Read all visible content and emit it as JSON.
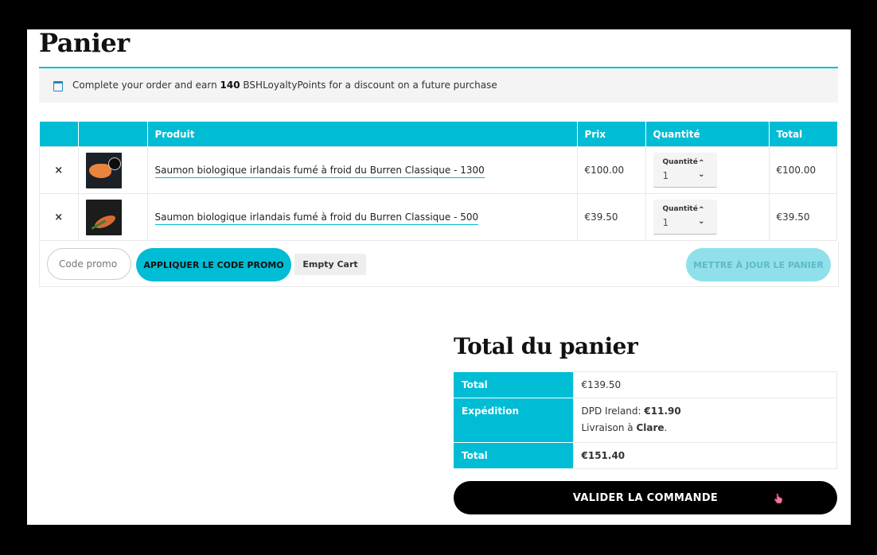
{
  "page_title": "Panier",
  "notice": {
    "text_before": "Complete your order and earn ",
    "points": "140",
    "text_after": " BSHLoyaltyPoints for a discount on a future purchase"
  },
  "cart_table": {
    "headers": [
      "",
      "",
      "Produit",
      "Prix",
      "Quantité",
      "Total"
    ],
    "rows": [
      {
        "remove": "×",
        "product": "Saumon biologique irlandais fumé à froid du Burren Classique - 1300",
        "price": "€100.00",
        "qty_label": "Quantité",
        "qty_value": "1",
        "total": "€100.00"
      },
      {
        "remove": "×",
        "product": "Saumon biologique irlandais fumé à froid du Burren Classique - 500",
        "price": "€39.50",
        "qty_label": "Quantité",
        "qty_value": "1",
        "total": "€39.50"
      }
    ]
  },
  "actions": {
    "promo_placeholder": "Code promo",
    "apply_promo": "APPLIQUER LE CODE PROMO",
    "empty_cart": "Empty Cart",
    "update_cart": "METTRE À JOUR LE PANIER"
  },
  "totals": {
    "title": "Total du panier",
    "subtotal_label": "Total",
    "subtotal_value": "€139.50",
    "shipping_label": "Expédition",
    "shipping_method": "DPD Ireland: ",
    "shipping_cost": "€11.90",
    "delivery_prefix": "Livraison à ",
    "delivery_place": "Clare",
    "delivery_suffix": ".",
    "total_label": "Total",
    "total_value": "€151.40"
  },
  "checkout_button": "VALIDER LA COMMANDE",
  "colors": {
    "accent": "#00bcd4",
    "remove": "#e02020",
    "checkout": "#000000"
  }
}
